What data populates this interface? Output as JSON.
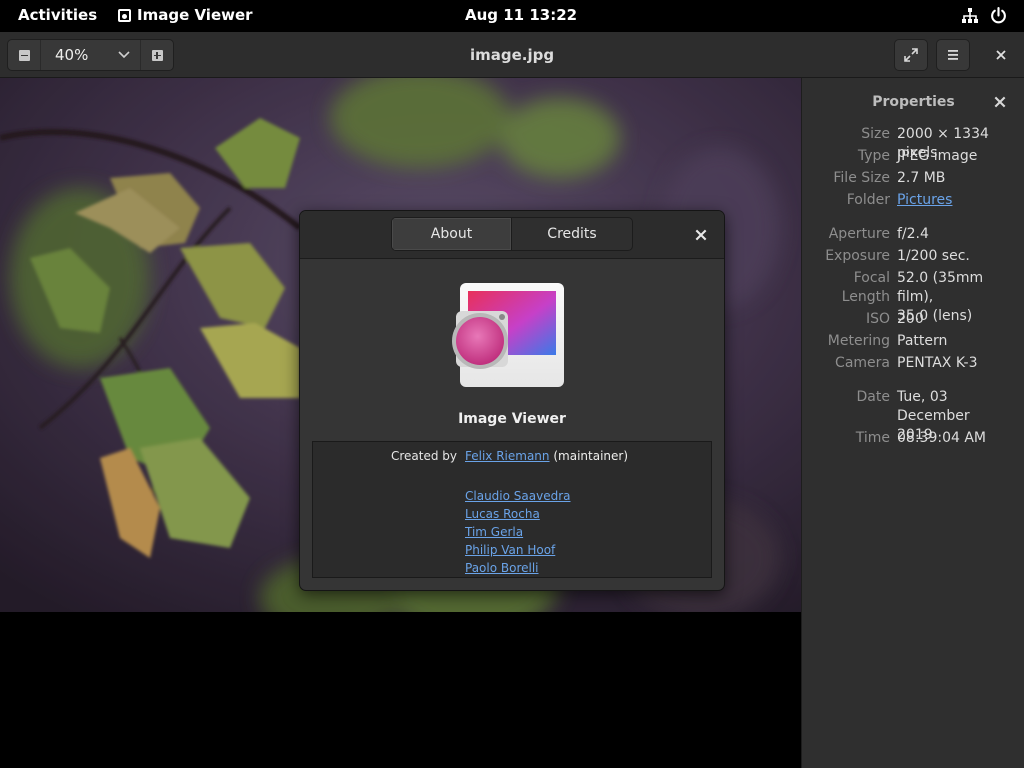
{
  "topbar": {
    "activities": "Activities",
    "app_name": "Image Viewer",
    "clock": "Aug 11  13:22",
    "icons": [
      "network-icon",
      "power-icon"
    ]
  },
  "header": {
    "zoom_value": "40%",
    "title": "image.jpg",
    "icons": [
      "zoom-out-icon",
      "chevron-down-icon",
      "zoom-in-icon",
      "fullscreen-icon",
      "hamburger-menu-icon",
      "close-icon"
    ]
  },
  "properties": {
    "title": "Properties",
    "rows": [
      {
        "key": "Size",
        "value": "2000 × 1334 pixels"
      },
      {
        "key": "Type",
        "value": "JPEG image"
      },
      {
        "key": "File Size",
        "value": "2.7 MB"
      },
      {
        "key": "Folder",
        "value": "Pictures"
      },
      {
        "key": "Aperture",
        "value": "f/2.4"
      },
      {
        "key": "Exposure",
        "value": "1/200 sec."
      },
      {
        "key": "Focal Length",
        "value": "52.0 (35mm film),\n35.0 (lens)"
      },
      {
        "key": "ISO",
        "value": "200"
      },
      {
        "key": "Metering",
        "value": "Pattern"
      },
      {
        "key": "Camera",
        "value": "PENTAX K-3"
      },
      {
        "key": "Date",
        "value": "Tue, 03 December\n2019"
      },
      {
        "key": "Time",
        "value": "08:39:04 AM"
      }
    ]
  },
  "about": {
    "tabs": [
      "About",
      "Credits"
    ],
    "app_name": "Image Viewer",
    "created_by_label": "Created by",
    "maintainer_name": "Felix Riemann",
    "maintainer_suffix": " (maintainer)",
    "contributors": [
      "Claudio Saavedra",
      "Lucas Rocha",
      "Tim Gerla",
      "Philip Van Hoof",
      "Paolo Borelli"
    ]
  },
  "colors": {
    "link": "#6aa3e8",
    "dialog_bg": "#353535",
    "sidebar_bg": "#2f2f2f"
  }
}
